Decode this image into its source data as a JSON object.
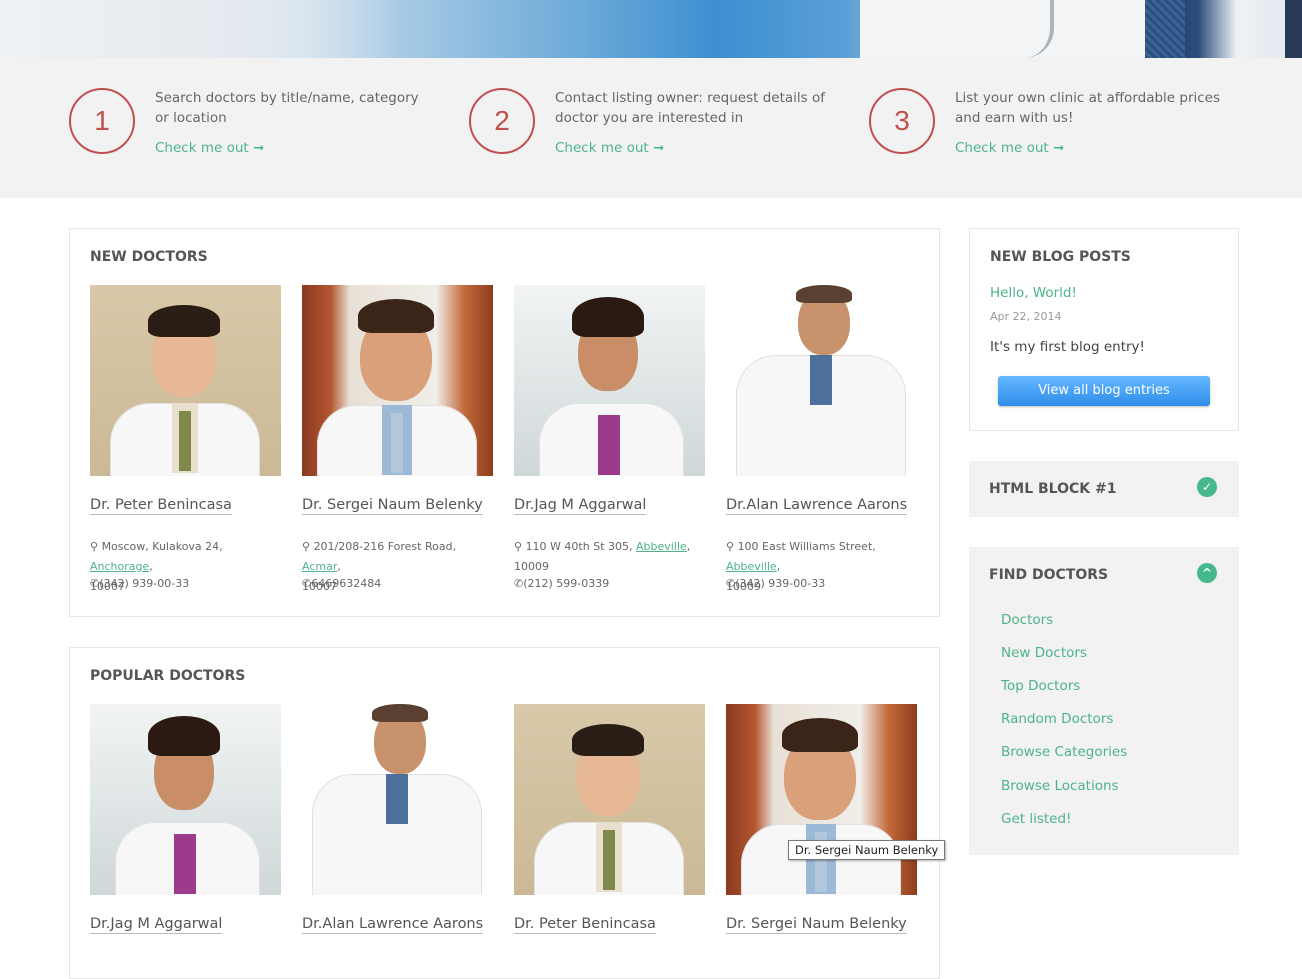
{
  "steps": [
    {
      "number": "1",
      "text": "Search doctors by title/name, category or location",
      "link": "Check me out"
    },
    {
      "number": "2",
      "text": "Contact listing owner: request details of doctor you are interested in",
      "link": "Check me out"
    },
    {
      "number": "3",
      "text": "List your own clinic at affordable prices and earn with us!",
      "link": "Check me out"
    }
  ],
  "new_doctors": {
    "title": "NEW DOCTORS",
    "items": [
      {
        "name": "Dr. Peter Benincasa",
        "address": "Moscow, Kulakova 24,",
        "city": "Anchorage",
        "zip": "10007",
        "phone": "(342) 939-00-33"
      },
      {
        "name": "Dr. Sergei Naum Belenky",
        "address": "201/208-216 Forest Road,",
        "city": "Acmar",
        "zip": "10007",
        "phone": "6469632484"
      },
      {
        "name": "Dr.Jag M Aggarwal",
        "address": "110 W 40th St 305,",
        "city": "Abbeville",
        "zip": "10009",
        "phone": "(212) 599-0339"
      },
      {
        "name": "Dr.Alan Lawrence Aarons",
        "address": "100 East Williams Street,",
        "city": "Abbeville",
        "zip": "10009",
        "phone": "(342) 939-00-33"
      }
    ]
  },
  "popular_doctors": {
    "title": "POPULAR DOCTORS",
    "items": [
      {
        "name": "Dr.Jag M Aggarwal"
      },
      {
        "name": "Dr.Alan Lawrence Aarons"
      },
      {
        "name": "Dr. Peter Benincasa"
      },
      {
        "name": "Dr. Sergei Naum Belenky"
      }
    ]
  },
  "blog": {
    "title": "NEW BLOG POSTS",
    "post_title": "Hello, World!",
    "post_date": "Apr 22, 2014",
    "post_text": "It's my first blog entry!",
    "button": "View all blog entries"
  },
  "html_block": {
    "title": "HTML BLOCK #1"
  },
  "find_doctors": {
    "title": "FIND DOCTORS",
    "items": [
      "Doctors",
      "New Doctors",
      "Top Doctors",
      "Random Doctors",
      "Browse Categories",
      "Browse Locations",
      "Get listed!"
    ]
  },
  "tooltip": "Dr. Sergei Naum Belenky",
  "colors": {
    "accent": "#4db38a",
    "step_circle": "#c0504d",
    "button": "#2e8eea"
  }
}
